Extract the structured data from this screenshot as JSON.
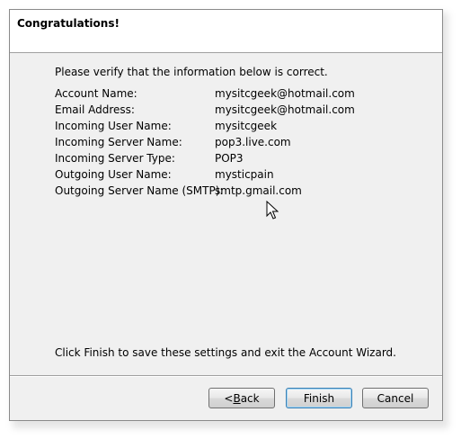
{
  "dialog": {
    "title": "Congratulations!",
    "intro": "Please verify that the information below is correct.",
    "info": [
      {
        "label": "Account Name:",
        "value": "mysitcgeek@hotmail.com"
      },
      {
        "label": "Email Address:",
        "value": "mysitcgeek@hotmail.com"
      },
      {
        "label": "Incoming User Name:",
        "value": "mysitcgeek"
      },
      {
        "label": "Incoming Server Name:",
        "value": "pop3.live.com"
      },
      {
        "label": "Incoming Server Type:",
        "value": "POP3"
      },
      {
        "label": "Outgoing User Name:",
        "value": "mysticpain"
      },
      {
        "label": "Outgoing Server Name (SMTP):",
        "value": "smtp.gmail.com"
      }
    ],
    "footer": "Click Finish to save these settings and exit the Account Wizard."
  },
  "buttons": {
    "back_prefix": "< ",
    "back_accel": "B",
    "back_rest": "ack",
    "finish": "Finish",
    "cancel": "Cancel"
  },
  "icons": {
    "cursor": "mouse-pointer-icon"
  }
}
